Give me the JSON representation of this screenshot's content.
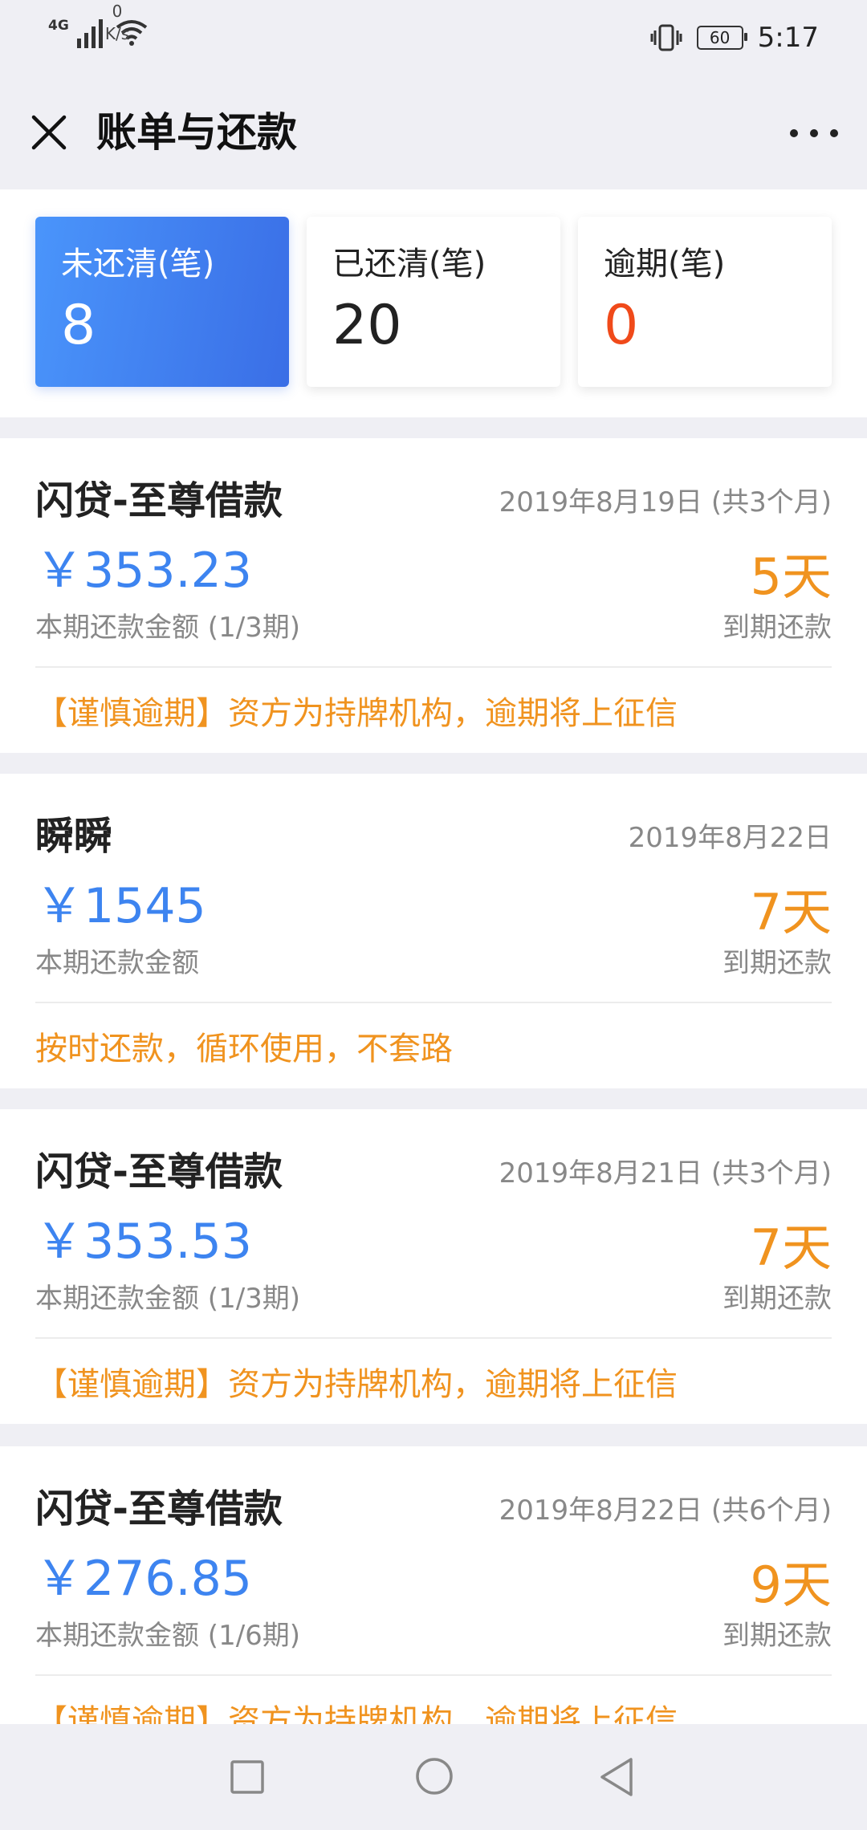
{
  "status_bar": {
    "network": "4G",
    "speed_value": "0",
    "speed_unit": "K/s",
    "battery": "60",
    "time": "5:17"
  },
  "header": {
    "title": "账单与还款"
  },
  "stats": [
    {
      "label": "未还清(笔)",
      "value": "8",
      "active": true
    },
    {
      "label": "已还清(笔)",
      "value": "20",
      "active": false
    },
    {
      "label": "逾期(笔)",
      "value": "0",
      "active": false
    }
  ],
  "bills": [
    {
      "name": "闪贷-至尊借款",
      "date": "2019年8月19日 (共3个月)",
      "amount": "￥353.23",
      "subtitle": "本期还款金额 (1/3期)",
      "days": "5天",
      "due_label": "到期还款",
      "notice": "【谨慎逾期】资方为持牌机构，逾期将上征信"
    },
    {
      "name": "瞬瞬",
      "date": "2019年8月22日",
      "amount": "￥1545",
      "subtitle": "本期还款金额",
      "days": "7天",
      "due_label": "到期还款",
      "notice": "按时还款，循环使用，不套路"
    },
    {
      "name": "闪贷-至尊借款",
      "date": "2019年8月21日 (共3个月)",
      "amount": "￥353.53",
      "subtitle": "本期还款金额 (1/3期)",
      "days": "7天",
      "due_label": "到期还款",
      "notice": "【谨慎逾期】资方为持牌机构，逾期将上征信"
    },
    {
      "name": "闪贷-至尊借款",
      "date": "2019年8月22日 (共6个月)",
      "amount": "￥276.85",
      "subtitle": "本期还款金额 (1/6期)",
      "days": "9天",
      "due_label": "到期还款",
      "notice": "【谨慎逾期】资方为持牌机构，逾期将上征信"
    }
  ],
  "colors": {
    "accent_blue": "#3d84f0",
    "orange": "#f0931f",
    "red": "#f04a1a"
  },
  "icons": [
    "signal-icon",
    "wifi-icon",
    "vibrate-icon",
    "battery-icon",
    "close-icon",
    "more-icon",
    "nav-back-icon",
    "nav-home-icon",
    "nav-recent-icon"
  ]
}
